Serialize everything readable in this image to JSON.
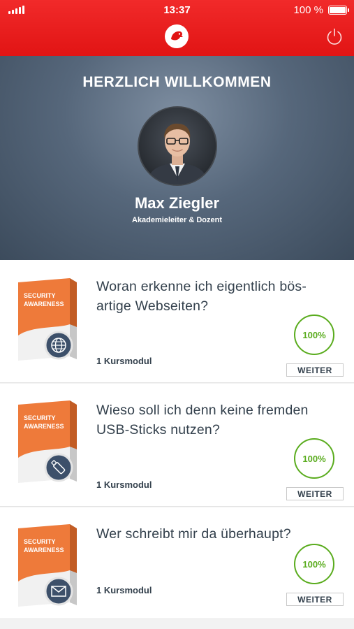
{
  "status_bar": {
    "time": "13:37",
    "battery": "100 %"
  },
  "header": {
    "logo_icon": "bird-logo-icon",
    "power_icon": "power-icon"
  },
  "hero": {
    "title": "HERZLICH WILLKOMMEN",
    "name": "Max Ziegler",
    "role": "Akademieleiter & Dozent"
  },
  "box_label": {
    "line1": "SECURITY",
    "line2": "AWARENESS"
  },
  "courses": [
    {
      "title_line1": "Woran erkenne ich eigentlich bös-",
      "title_line2": "artige Webseiten?",
      "meta": "1 Kursmodul",
      "progress": "100%",
      "button": "WEITER",
      "icon": "globe-icon"
    },
    {
      "title_line1": "Wieso soll ich denn keine fremden",
      "title_line2": "USB-Sticks nutzen?",
      "meta": "1 Kursmodul",
      "progress": "100%",
      "button": "WEITER",
      "icon": "usb-stick-icon"
    },
    {
      "title_line1": "Wer schreibt mir da überhaupt?",
      "title_line2": "",
      "meta": "1 Kursmodul",
      "progress": "100%",
      "button": "WEITER",
      "icon": "envelope-icon"
    }
  ],
  "colors": {
    "header_red": "#e11414",
    "progress_green": "#5aac1e",
    "box_orange": "#ee7a3a"
  }
}
